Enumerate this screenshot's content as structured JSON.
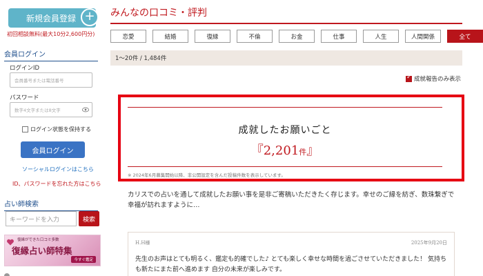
{
  "sidebar": {
    "register_label": "新規会員登録",
    "register_plus": "+",
    "free_consult": "初回相談無料(最大10分2,600円分)",
    "login": {
      "title": "会員ログイン",
      "id_label": "ログインID",
      "id_placeholder": "会員番号または電話番号",
      "password_label": "パスワード",
      "password_placeholder": "数字4文字または8文字",
      "keep_login_label": "ログイン状態を保持する",
      "login_button": "会員ログイン",
      "social_login_link": "ソーシャルログインはこちら",
      "forgot_link": "ID、パスワードを忘れた方はこちら"
    },
    "search": {
      "title": "占い師検索",
      "keyword_placeholder": "キーワードを入力",
      "search_button": "検索"
    },
    "banner": {
      "top_text": "復縁ができた口コミ多数",
      "main_text": "復縁占い師特集",
      "cta": "今すぐ鑑定"
    }
  },
  "main": {
    "title": "みんなの口コミ・評判",
    "tabs": [
      {
        "label": "恋愛",
        "active": false
      },
      {
        "label": "結婚",
        "active": false
      },
      {
        "label": "復縁",
        "active": false
      },
      {
        "label": "不倫",
        "active": false
      },
      {
        "label": "お金",
        "active": false
      },
      {
        "label": "仕事",
        "active": false
      },
      {
        "label": "人生",
        "active": false
      },
      {
        "label": "人間関係",
        "active": false
      },
      {
        "label": "全て",
        "active": true
      }
    ],
    "result_count": "1〜20件 / 1,484件",
    "success_filter_label": "成就報告のみ表示",
    "wish": {
      "title": "成就したお願いごと",
      "open_bracket": "『",
      "count": "2,201",
      "unit": "件",
      "close_bracket": "』",
      "note": "※ 2024年6月募集開始以降、非公開設定を含んだ投稿件数を表示しています。"
    },
    "intro": "カリスでの占いを通して成就したお願い事を是非ご寄稿いただきたく存じます。幸せのご縁を紡ぎ、数珠繋ぎで幸福が訪れますように…",
    "review": {
      "name": "H.H様",
      "date": "2025年9月20日",
      "body": "先生のお声はとても明るく、鑑定も的確でした♪ とても楽しく幸せな時間を過ごさせていただきました！ 気持ちも新たにまた前へ進めます 自分の未来が楽しみです。"
    }
  },
  "colors": {
    "accent_red": "#c0181e",
    "highlight_red": "#e60012",
    "teal": "#5fb4c9",
    "blue_button": "#3a73c4"
  }
}
